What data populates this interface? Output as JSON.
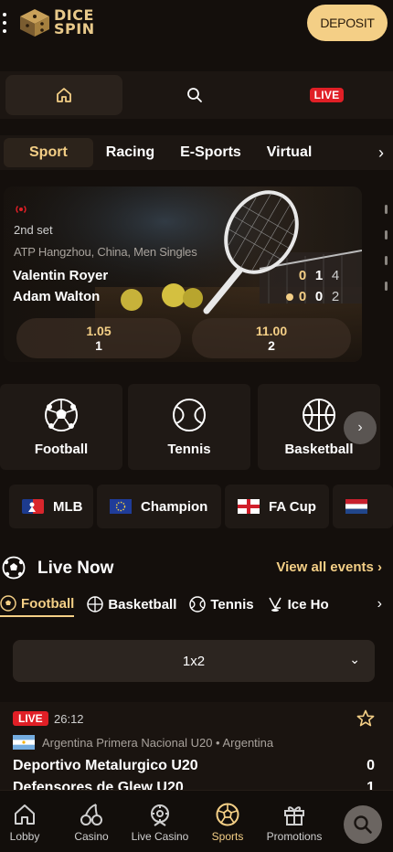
{
  "header": {
    "logo_line1": "DICE",
    "logo_line2": "SPIN",
    "deposit_label": "DEPOSIT"
  },
  "quicknav": {
    "live_label": "LIVE",
    "icons": [
      "home-icon",
      "search-icon",
      "live-badge"
    ]
  },
  "category_tabs": [
    "Sport",
    "Racing",
    "E-Sports",
    "Virtual"
  ],
  "featured_match": {
    "set": "2nd set",
    "tournament": "ATP Hangzhou, China, Men Singles",
    "player1": "Valentin Royer",
    "player2": "Adam Walton",
    "score1": [
      "0",
      "1",
      "4"
    ],
    "score2": [
      "0",
      "0",
      "2"
    ],
    "odds": [
      {
        "value": "1.05",
        "label": "1"
      },
      {
        "value": "11.00",
        "label": "2"
      }
    ]
  },
  "sport_tiles": [
    "Football",
    "Tennis",
    "Basketball"
  ],
  "leagues": [
    "MLB",
    "Champion",
    "FA Cup",
    ""
  ],
  "live_now": {
    "title": "Live Now",
    "view_all": "View all events",
    "sports": [
      "Football",
      "Basketball",
      "Tennis",
      "Ice Ho"
    ],
    "market": "1x2"
  },
  "event": {
    "live": "LIVE",
    "time": "26:12",
    "league": "Argentina Primera Nacional U20 • Argentina",
    "team1": "Deportivo Metalurgico U20",
    "team2": "Defensores de Glew U20",
    "score1": "0",
    "score2": "1"
  },
  "bottom_nav": [
    "Lobby",
    "Casino",
    "Live Casino",
    "Sports",
    "Promotions"
  ],
  "colors": {
    "accent": "#f4cf86",
    "background": "#140f0c",
    "live_red": "#e01f26"
  }
}
